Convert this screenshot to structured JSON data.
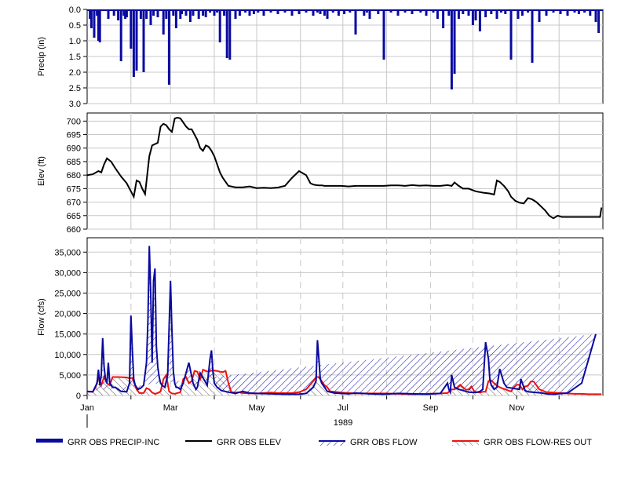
{
  "chart_data": [
    {
      "type": "bar",
      "id": "precip",
      "ylabel": "Precip (in)",
      "yticks": [
        "0.0",
        "0.5",
        "1.0",
        "1.5",
        "2.0",
        "2.5",
        "3.0"
      ],
      "ylim": [
        0,
        3.0
      ],
      "inverted": true,
      "series": [
        {
          "name": "GRR OBS PRECIP-INC",
          "color": "#0a0aa0",
          "days": [
            2,
            3,
            5,
            7,
            8,
            9,
            15,
            19,
            22,
            24,
            26,
            27,
            28,
            31,
            33,
            35,
            38,
            40,
            42,
            45,
            47,
            50,
            54,
            56,
            58,
            61,
            63,
            66,
            67,
            70,
            73,
            75,
            79,
            82,
            84,
            87,
            90,
            92,
            94,
            97,
            99,
            101,
            105,
            108,
            112,
            115,
            118,
            121,
            125,
            130,
            135,
            140,
            145,
            150,
            155,
            160,
            163,
            165,
            168,
            170,
            174,
            178,
            182,
            186,
            190,
            196,
            198,
            200,
            206,
            210,
            215,
            220,
            225,
            230,
            236,
            240,
            245,
            248,
            252,
            256,
            258,
            260,
            263,
            266,
            270,
            273,
            275,
            278,
            282,
            286,
            290,
            293,
            296,
            300,
            305,
            308,
            312,
            315,
            320,
            325,
            330,
            335,
            340,
            345,
            348,
            352,
            356,
            360,
            362
          ],
          "values": [
            0.3,
            0.6,
            0.9,
            0.2,
            1.0,
            1.05,
            0.3,
            0.2,
            0.35,
            1.65,
            0.2,
            0.3,
            0.25,
            1.25,
            2.15,
            1.95,
            0.3,
            2.0,
            0.3,
            0.5,
            0.2,
            0.25,
            0.8,
            0.3,
            2.4,
            0.2,
            0.6,
            0.3,
            0.15,
            0.2,
            0.4,
            0.2,
            0.3,
            0.2,
            0.25,
            0.1,
            0.2,
            0.1,
            1.05,
            0.2,
            1.55,
            1.6,
            0.3,
            0.2,
            0.1,
            0.2,
            0.15,
            0.1,
            0.2,
            0.1,
            0.15,
            0.1,
            0.2,
            0.15,
            0.1,
            0.2,
            0.1,
            0.15,
            0.2,
            0.3,
            0.1,
            0.2,
            0.15,
            0.1,
            0.8,
            0.2,
            0.1,
            0.3,
            0.15,
            1.6,
            0.1,
            0.2,
            0.1,
            0.15,
            0.1,
            0.2,
            0.1,
            0.3,
            0.6,
            0.2,
            2.55,
            2.05,
            0.3,
            0.15,
            0.2,
            0.5,
            0.35,
            0.7,
            0.25,
            0.15,
            0.3,
            0.1,
            0.15,
            1.6,
            0.3,
            0.2,
            0.1,
            1.7,
            0.4,
            0.2,
            0.1,
            0.15,
            0.2,
            0.1,
            0.15,
            0.1,
            0.2,
            0.4,
            0.75
          ]
        }
      ]
    },
    {
      "type": "line",
      "id": "elev",
      "ylabel": "Elev (ft)",
      "yticks": [
        "660",
        "665",
        "670",
        "675",
        "680",
        "685",
        "690",
        "695",
        "700"
      ],
      "ylim": [
        660,
        703
      ],
      "series": [
        {
          "name": "GRR OBS ELEV",
          "color": "#000000",
          "days": [
            0,
            4,
            8,
            10,
            12,
            14,
            17,
            20,
            24,
            28,
            31,
            33,
            35,
            37,
            39,
            41,
            44,
            46,
            50,
            52,
            54,
            56,
            58,
            60,
            62,
            64,
            66,
            68,
            70,
            72,
            74,
            76,
            78,
            80,
            82,
            84,
            86,
            88,
            90,
            92,
            94,
            96,
            100,
            105,
            110,
            115,
            120,
            125,
            130,
            135,
            140,
            145,
            150,
            155,
            158,
            160,
            162,
            164,
            166,
            168,
            170,
            175,
            180,
            185,
            190,
            195,
            200,
            205,
            210,
            215,
            220,
            225,
            230,
            235,
            240,
            245,
            250,
            255,
            258,
            260,
            263,
            266,
            270,
            275,
            280,
            285,
            288,
            290,
            292,
            295,
            298,
            300,
            303,
            306,
            309,
            312,
            315,
            318,
            321,
            324,
            327,
            330,
            333,
            336,
            339,
            342,
            345,
            348,
            351,
            354,
            357,
            360,
            363,
            364
          ],
          "values": [
            680,
            680.3,
            681.5,
            681,
            684,
            686.2,
            685,
            682.5,
            679.5,
            677,
            674,
            672,
            678,
            677.5,
            675,
            673,
            687,
            691,
            692,
            698,
            699,
            698.5,
            697,
            696,
            701,
            701.3,
            701,
            699.5,
            698,
            697,
            697,
            695,
            693,
            690,
            689,
            691,
            690.5,
            689,
            687,
            684,
            681,
            679,
            676,
            675.5,
            675.5,
            675.8,
            675.2,
            675.3,
            675.2,
            675.4,
            676,
            679,
            681.5,
            680,
            677,
            676.5,
            676.3,
            676.2,
            676.2,
            676,
            676,
            676,
            676,
            675.8,
            676,
            676,
            676,
            676,
            676,
            676.2,
            676.2,
            676,
            676.3,
            676.1,
            676.2,
            676,
            676,
            676.3,
            676,
            677.3,
            676,
            675,
            675,
            674,
            673.5,
            673.2,
            672.8,
            678,
            677.5,
            676,
            674,
            672,
            670.5,
            669.8,
            669.5,
            671.5,
            671,
            670,
            668.5,
            667,
            665,
            664,
            665,
            664.5,
            664.5,
            664.5,
            664.5,
            664.5,
            664.5,
            664.5,
            664.5,
            664.5,
            664.5,
            668
          ]
        }
      ]
    },
    {
      "type": "area",
      "id": "flow",
      "ylabel": "Flow (cfs)",
      "yticks": [
        "0",
        "5,000",
        "10,000",
        "15,000",
        "20,000",
        "25,000",
        "30,000",
        "35,000"
      ],
      "ylim": [
        0,
        38500
      ],
      "xticks": [
        "Jan",
        "Mar",
        "May",
        "Jul",
        "Sep",
        "Nov"
      ],
      "year_label": "1989",
      "series": [
        {
          "name": "GRR OBS FLOW",
          "color": "#0a0aa0",
          "days": [
            0,
            4,
            7,
            8,
            9,
            10,
            11,
            12,
            13,
            14,
            15,
            16,
            18,
            20,
            24,
            28,
            30,
            31,
            32,
            33,
            34,
            35,
            36,
            38,
            40,
            42,
            43,
            44,
            45,
            46,
            47,
            48,
            49,
            50,
            51,
            52,
            53,
            55,
            57,
            59,
            60,
            61,
            62,
            63,
            64,
            66,
            68,
            72,
            75,
            77,
            78,
            80,
            85,
            87,
            88,
            89,
            90,
            92,
            95,
            100,
            105,
            110,
            115,
            120,
            130,
            140,
            150,
            155,
            160,
            162,
            163,
            164,
            165,
            166,
            168,
            170,
            175,
            180,
            185,
            190,
            200,
            210,
            220,
            230,
            240,
            250,
            255,
            256,
            257,
            258,
            260,
            263,
            266,
            270,
            275,
            278,
            280,
            282,
            284,
            285,
            286,
            287,
            288,
            290,
            292,
            295,
            297,
            306,
            307,
            308,
            310,
            312,
            315,
            322,
            325,
            330,
            340,
            350,
            360,
            362,
            363,
            364
          ],
          "values": [
            1000,
            900,
            3000,
            6300,
            2500,
            5000,
            14000,
            7000,
            4000,
            3000,
            8000,
            3000,
            2000,
            2000,
            1000,
            900,
            3000,
            19500,
            11000,
            4000,
            2500,
            2000,
            1500,
            1800,
            2500,
            8000,
            18000,
            36500,
            25000,
            8000,
            28000,
            31000,
            12000,
            7000,
            4500,
            3000,
            2500,
            2000,
            5000,
            28000,
            16000,
            6000,
            3000,
            2000,
            2000,
            1500,
            3000,
            8000,
            3000,
            1500,
            2000,
            5500,
            2500,
            9000,
            11000,
            6000,
            3000,
            2000,
            1200,
            800,
            500,
            1000,
            600,
            500,
            400,
            300,
            300,
            500,
            2000,
            3500,
            13500,
            9000,
            4000,
            3000,
            2000,
            1000,
            600,
            500,
            400,
            600,
            400,
            300,
            500,
            400,
            300,
            500,
            3000,
            1500,
            800,
            5000,
            2000,
            1500,
            1200,
            800,
            700,
            1000,
            1500,
            13000,
            9000,
            4000,
            2500,
            2000,
            1500,
            2000,
            6500,
            3000,
            2000,
            1500,
            4000,
            3000,
            1200,
            900,
            800,
            600,
            400,
            300,
            600,
            3000,
            15000
          ]
        },
        {
          "name": "GRR OBS FLOW-RES OUT",
          "color": "#ee1111",
          "days": [
            0,
            4,
            6,
            8,
            10,
            12,
            14,
            16,
            18,
            20,
            22,
            28,
            30,
            32,
            35,
            37,
            40,
            42,
            44,
            46,
            48,
            50,
            52,
            54,
            56,
            58,
            60,
            62,
            64,
            66,
            68,
            70,
            72,
            74,
            76,
            78,
            80,
            82,
            84,
            86,
            88,
            90,
            92,
            94,
            96,
            98,
            100,
            102,
            105,
            108,
            110,
            115,
            120,
            125,
            130,
            135,
            140,
            145,
            150,
            155,
            160,
            162,
            164,
            166,
            168,
            170,
            172,
            175,
            180,
            185,
            190,
            200,
            210,
            220,
            230,
            240,
            250,
            255,
            258,
            260,
            262,
            264,
            266,
            268,
            270,
            272,
            274,
            276,
            278,
            280,
            282,
            284,
            286,
            288,
            290,
            292,
            294,
            296,
            298,
            300,
            302,
            304,
            306,
            308,
            310,
            312,
            314,
            316,
            318,
            320,
            325,
            330,
            335,
            340,
            345,
            350,
            355,
            360,
            364
          ],
          "values": [
            900,
            900,
            2000,
            4500,
            2500,
            4500,
            3000,
            2500,
            4500,
            4500,
            4500,
            4400,
            4200,
            4300,
            1500,
            600,
            600,
            1800,
            1500,
            700,
            400,
            600,
            1000,
            4000,
            5000,
            1000,
            500,
            400,
            600,
            800,
            4000,
            4500,
            3000,
            3500,
            6000,
            5800,
            4000,
            6300,
            6000,
            5800,
            6100,
            6100,
            6000,
            5800,
            5700,
            6000,
            3000,
            800,
            700,
            800,
            600,
            500,
            500,
            600,
            700,
            600,
            600,
            600,
            800,
            1500,
            3500,
            4500,
            4500,
            3500,
            2500,
            2000,
            1000,
            900,
            700,
            600,
            500,
            500,
            500,
            400,
            300,
            400,
            500,
            600,
            1500,
            1500,
            2000,
            2600,
            2000,
            1400,
            1500,
            2200,
            1000,
            800,
            700,
            900,
            900,
            3500,
            3700,
            3000,
            2400,
            2000,
            1700,
            1500,
            1200,
            1000,
            2000,
            2600,
            2600,
            1500,
            2200,
            2400,
            3400,
            3400,
            2500,
            1500,
            800,
            700,
            600,
            500,
            400,
            400,
            300,
            300,
            300,
            300
          ]
        }
      ]
    }
  ]
}
